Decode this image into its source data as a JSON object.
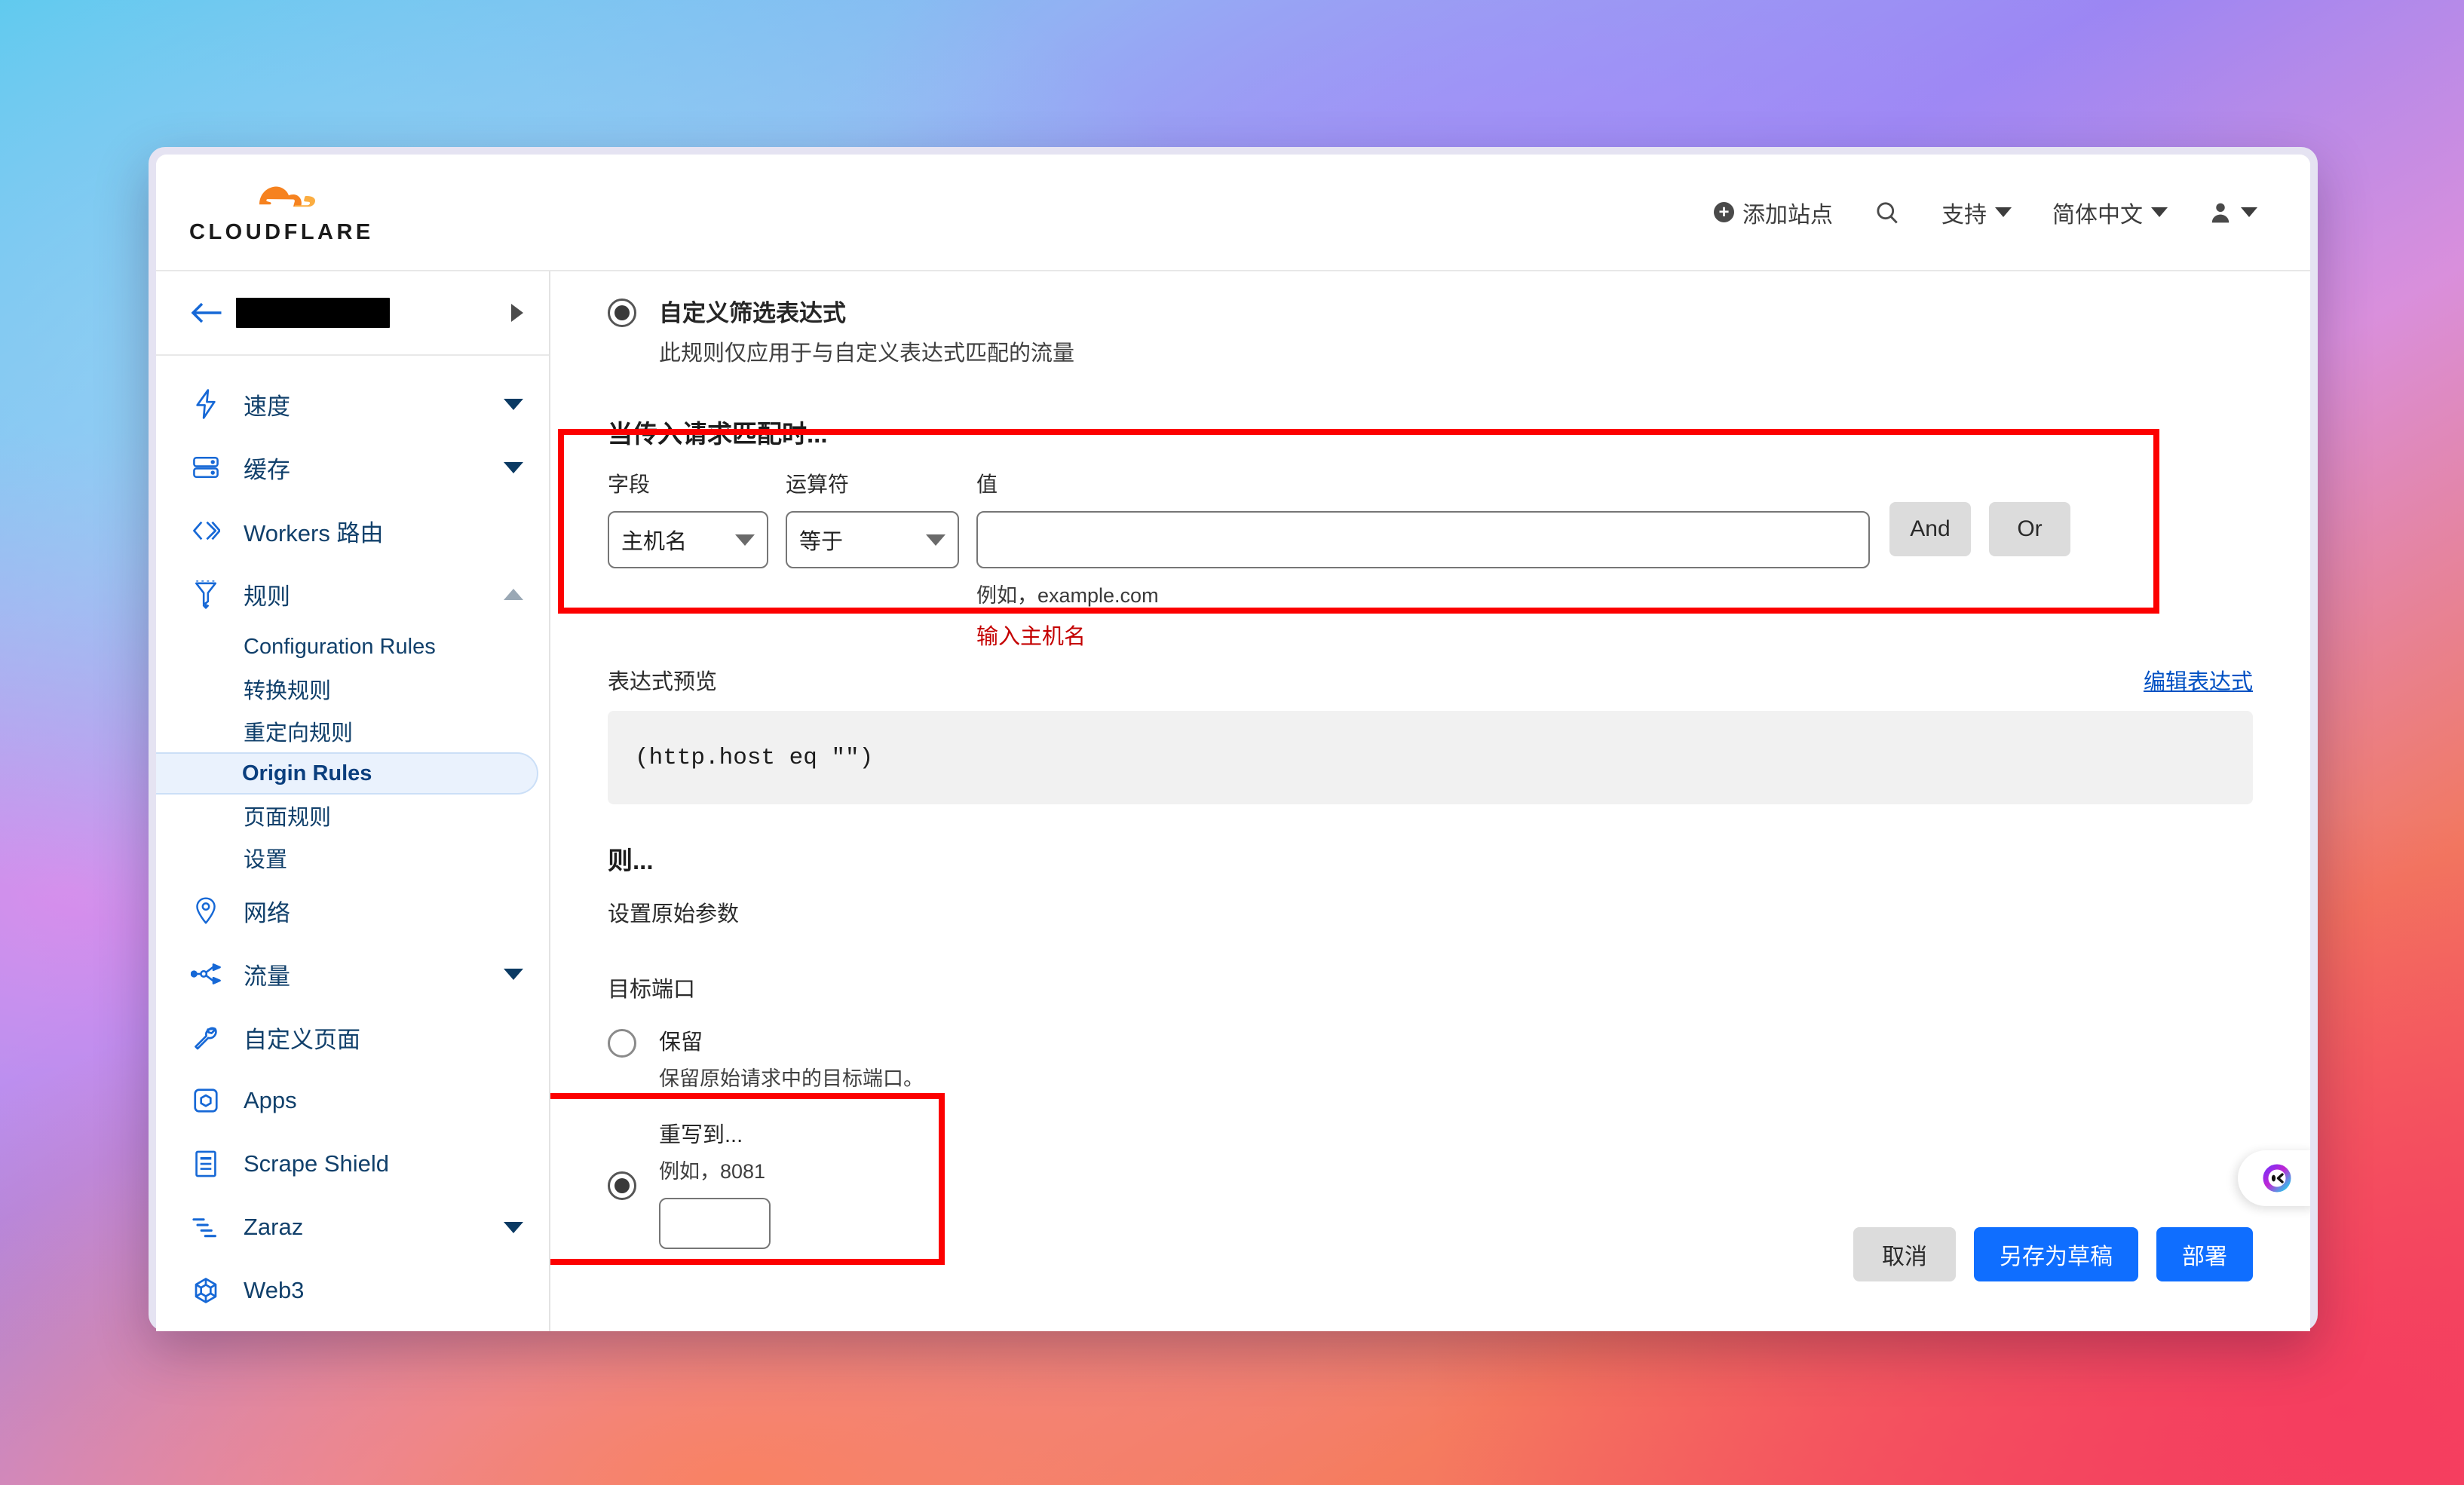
{
  "header": {
    "logo_word": "CLOUDFLARE",
    "add_site_label": "添加站点",
    "search_icon": "search-icon",
    "support_label": "支持",
    "language_label": "简体中文",
    "account_icon": "user-avatar-icon"
  },
  "sidebar": {
    "site_name_redacted": "",
    "items": [
      {
        "label": "速度",
        "icon": "lightning-bolt-icon",
        "expandable": true,
        "expanded": false
      },
      {
        "label": "缓存",
        "icon": "server-stack-icon",
        "expandable": true,
        "expanded": false
      },
      {
        "label": "Workers 路由",
        "icon": "code-brackets-icon",
        "expandable": false
      },
      {
        "label": "规则",
        "icon": "funnel-filter-icon",
        "expandable": true,
        "expanded": true
      }
    ],
    "rules_children": [
      {
        "label": "Configuration Rules",
        "active": false
      },
      {
        "label": "转换规则",
        "active": false
      },
      {
        "label": "重定向规则",
        "active": false
      },
      {
        "label": "Origin Rules",
        "active": true
      },
      {
        "label": "页面规则",
        "active": false
      },
      {
        "label": "设置",
        "active": false
      }
    ],
    "items_after": [
      {
        "label": "网络",
        "icon": "location-pin-icon",
        "expandable": false
      },
      {
        "label": "流量",
        "icon": "traffic-share-icon",
        "expandable": true,
        "expanded": false
      },
      {
        "label": "自定义页面",
        "icon": "wrench-icon",
        "expandable": false
      },
      {
        "label": "Apps",
        "icon": "app-box-icon",
        "expandable": false
      },
      {
        "label": "Scrape Shield",
        "icon": "document-lines-icon",
        "expandable": false
      },
      {
        "label": "Zaraz",
        "icon": "zaraz-bars-icon",
        "expandable": true,
        "expanded": false
      },
      {
        "label": "Web3",
        "icon": "web3-hexagon-icon",
        "expandable": false
      }
    ]
  },
  "main": {
    "filter_option": {
      "title": "自定义筛选表达式",
      "subtitle": "此规则仅应用于与自定义表达式匹配的流量",
      "selected": true
    },
    "when_heading": "当传入请求匹配时...",
    "match_row": {
      "field_label": "字段",
      "field_value": "主机名",
      "operator_label": "运算符",
      "operator_value": "等于",
      "value_label": "值",
      "value_text": "",
      "value_placeholder": "",
      "example_hint": "例如，example.com",
      "error_text": "输入主机名",
      "and_label": "And",
      "or_label": "Or"
    },
    "preview": {
      "title": "表达式预览",
      "edit_link": "编辑表达式",
      "expression": "(http.host eq \"\")"
    },
    "then_heading": "则...",
    "then_sub": "设置原始参数",
    "port_heading": "目标端口",
    "preserve_option": {
      "title": "保留",
      "subtitle": "保留原始请求中的目标端口。",
      "selected": false
    },
    "rewrite_option": {
      "title": "重写到...",
      "subtitle": "例如，8081",
      "selected": true,
      "port_value": "",
      "port_placeholder": ""
    },
    "actions": {
      "cancel": "取消",
      "save_draft": "另存为草稿",
      "deploy": "部署"
    },
    "chat_widget_icon": "chat-bubble-face-icon"
  },
  "colors": {
    "brand_orange": "#f6821f",
    "nav_blue": "#11406b",
    "primary_blue": "#0f6eff",
    "error_red": "#c40000",
    "annotation_red": "#fc0000",
    "active_bg": "#eaf2fd"
  }
}
